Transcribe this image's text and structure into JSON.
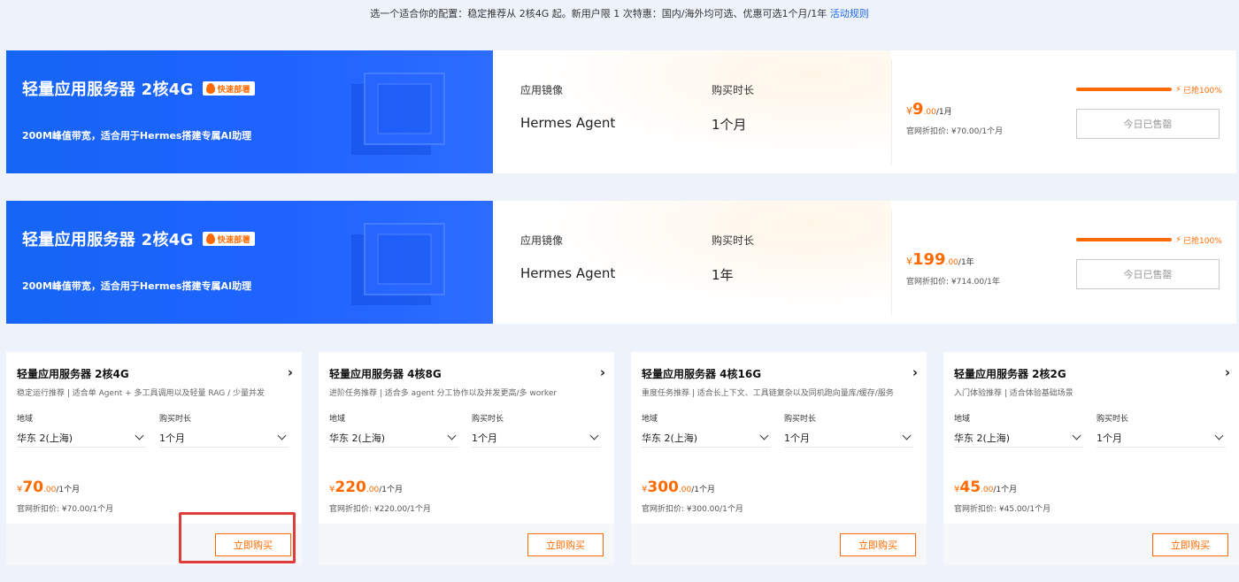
{
  "top_note": {
    "text": "选一个适合你的配置：稳定推荐从 2核4G 起。新用户限 1 次特惠：国内/海外均可选、优惠可选1个月/1年",
    "link": "活动规则"
  },
  "banners": [
    {
      "title": "轻量应用服务器 2核4G",
      "tag": "快速部署",
      "subtitle": "200M峰值带宽，适合用于Hermes搭建专属AI助理",
      "image_label": "应用镜像",
      "image_value": "Hermes Agent",
      "duration_label": "购买时长",
      "duration_value": "1个月",
      "price_currency": "¥",
      "price_int": "9",
      "price_cents": ".00",
      "price_per": "/1月",
      "price_orig": "官网折扣价: ¥70.00/1个月",
      "progress_label": "已抢100%",
      "progress_value": 1.0,
      "button": "今日已售罄"
    },
    {
      "title": "轻量应用服务器 2核4G",
      "tag": "快速部署",
      "subtitle": "200M峰值带宽，适合用于Hermes搭建专属AI助理",
      "image_label": "应用镜像",
      "image_value": "Hermes Agent",
      "duration_label": "购买时长",
      "duration_value": "1年",
      "price_currency": "¥",
      "price_int": "199",
      "price_cents": ".00",
      "price_per": "/1年",
      "price_orig": "官网折扣价: ¥714.00/1年",
      "progress_label": "已抢100%",
      "progress_value": 1.0,
      "button": "今日已售罄"
    }
  ],
  "cards": [
    {
      "title": "轻量应用服务器 2核4G",
      "desc": "稳定运行推荐 | 适合单 Agent + 多工具调用以及轻量 RAG / 少量并发",
      "region_label": "地域",
      "region_value": "华东 2(上海)",
      "duration_label": "购买时长",
      "duration_value": "1个月",
      "price_currency": "¥",
      "price_int": "70",
      "price_cents": ".00",
      "price_per": "/1个月",
      "price_orig": "官网折扣价: ¥70.00/1个月",
      "button": "立即购买"
    },
    {
      "title": "轻量应用服务器 4核8G",
      "desc": "进阶任务推荐 | 适合多 agent 分工协作以及并发更高/多 worker",
      "region_label": "地域",
      "region_value": "华东 2(上海)",
      "duration_label": "购买时长",
      "duration_value": "1个月",
      "price_currency": "¥",
      "price_int": "220",
      "price_cents": ".00",
      "price_per": "/1个月",
      "price_orig": "官网折扣价: ¥220.00/1个月",
      "button": "立即购买"
    },
    {
      "title": "轻量应用服务器 4核16G",
      "desc": "重度任务推荐 | 适合长上下文、工具链复杂以及同机跑向量库/缓存/服务",
      "region_label": "地域",
      "region_value": "华东 2(上海)",
      "duration_label": "购买时长",
      "duration_value": "1个月",
      "price_currency": "¥",
      "price_int": "300",
      "price_cents": ".00",
      "price_per": "/1个月",
      "price_orig": "官网折扣价: ¥300.00/1个月",
      "button": "立即购买"
    },
    {
      "title": "轻量应用服务器 2核2G",
      "desc": "入门体验推荐 | 适合体验基础场景",
      "region_label": "地域",
      "region_value": "华东 2(上海)",
      "duration_label": "购买时长",
      "duration_value": "1个月",
      "price_currency": "¥",
      "price_int": "45",
      "price_cents": ".00",
      "price_per": "/1个月",
      "price_orig": "官网折扣价: ¥45.00/1个月",
      "button": "立即购买"
    }
  ],
  "colors": {
    "accent": "#ff6a00",
    "banner_blue": "#1f63ff",
    "link": "#1e67f0",
    "highlight": "#e03c3c"
  }
}
